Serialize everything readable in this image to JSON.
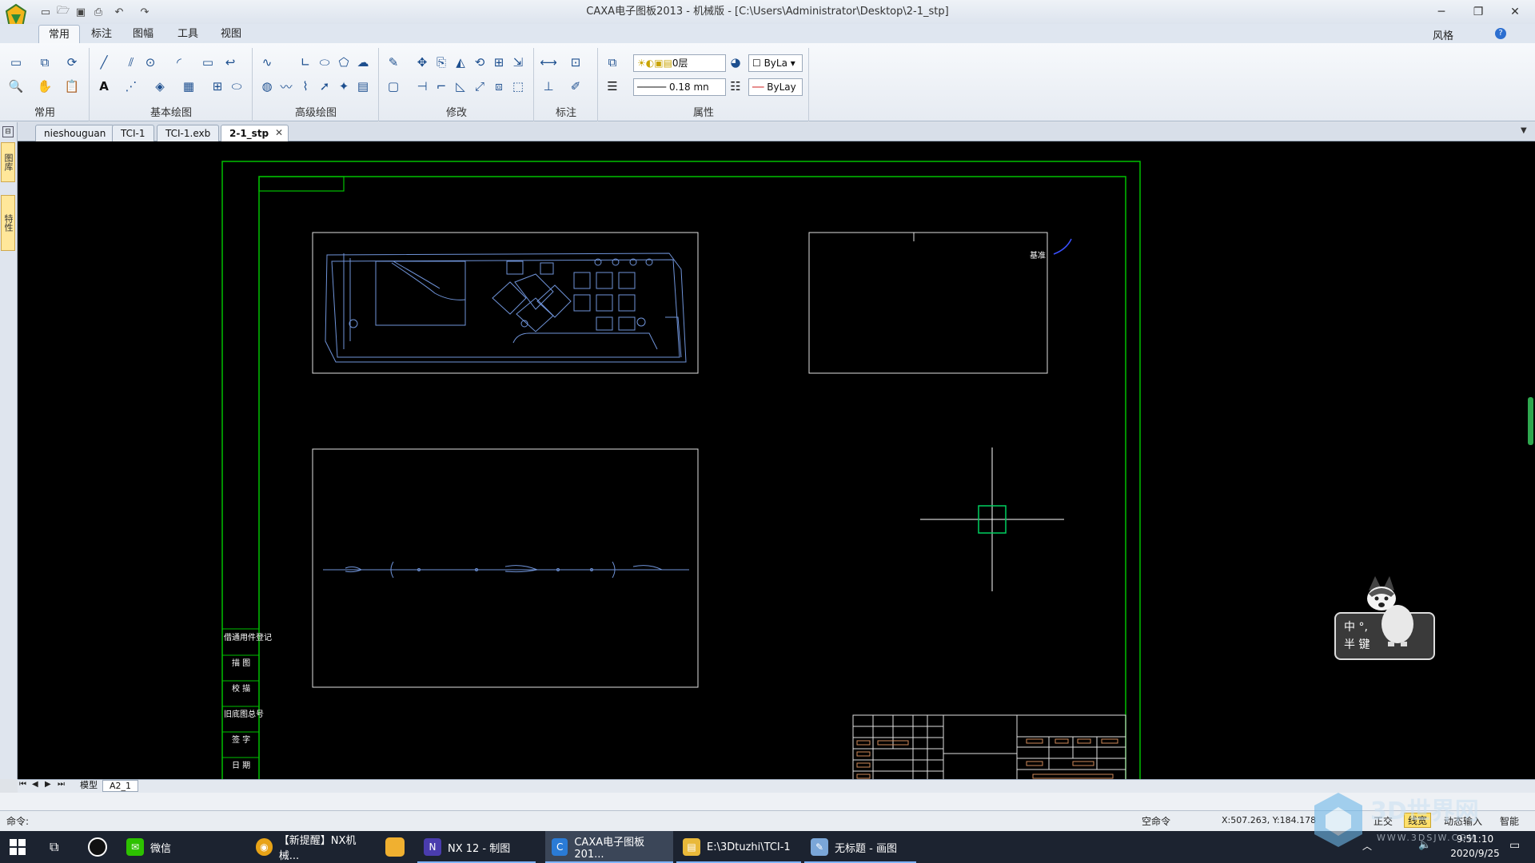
{
  "app": {
    "title": "CAXA电子图板2013 - 机械版 - [C:\\Users\\Administrator\\Desktop\\2-1_stp]"
  },
  "ribbon": {
    "tabs": [
      {
        "label": "常用"
      },
      {
        "label": "标注"
      },
      {
        "label": "图幅"
      },
      {
        "label": "工具"
      },
      {
        "label": "视图"
      }
    ],
    "style_label": "风格",
    "groups": [
      {
        "label": "常用"
      },
      {
        "label": "基本绘图"
      },
      {
        "label": "高级绘图"
      },
      {
        "label": "修改"
      },
      {
        "label": "标注"
      },
      {
        "label": "属性"
      }
    ],
    "layer_value": "0层",
    "linewidth_value": "0.18 mn",
    "color_value": "ByLa",
    "linetype_value": "ByLay"
  },
  "documents": {
    "tabs": [
      {
        "label": "nieshouguan"
      },
      {
        "label": "TCI-1"
      },
      {
        "label": "TCI-1.exb"
      },
      {
        "label": "2-1_stp"
      }
    ]
  },
  "left_panel": {
    "buttons": [
      {
        "label": "图库"
      },
      {
        "label": "特性"
      }
    ]
  },
  "drawing": {
    "annotation": "基准",
    "side_table": [
      {
        "label": "借通用件登记"
      },
      {
        "label": "描 图"
      },
      {
        "label": "校 描"
      },
      {
        "label": "旧底图总号"
      },
      {
        "label": "签 字"
      },
      {
        "label": "日 期"
      }
    ],
    "ime_widget": {
      "line1": "中 °,",
      "line2": "半 键"
    }
  },
  "sheet_tabs": [
    {
      "label": "模型"
    },
    {
      "label": "A2_1"
    }
  ],
  "command": {
    "prompt": "命令:",
    "status": "空命令",
    "coords": "X:507.263, Y:184.178",
    "mode1": "正交",
    "mode2": "线宽",
    "mode3": "动态输入",
    "mode4": "智能"
  },
  "taskbar": {
    "items": [
      {
        "label": "微信"
      },
      {
        "label": "【新提醒】NX机械..."
      },
      {
        "label": "NX 12 - 制图"
      },
      {
        "label": "CAXA电子图板201..."
      },
      {
        "label": "E:\\3Dtuzhi\\TCI-1"
      },
      {
        "label": "无标题 - 画图"
      }
    ],
    "time": "9:51:10",
    "date": "2020/9/25"
  },
  "watermark": {
    "text": "3D世界网",
    "url": "WWW.3DSJW.COM"
  }
}
